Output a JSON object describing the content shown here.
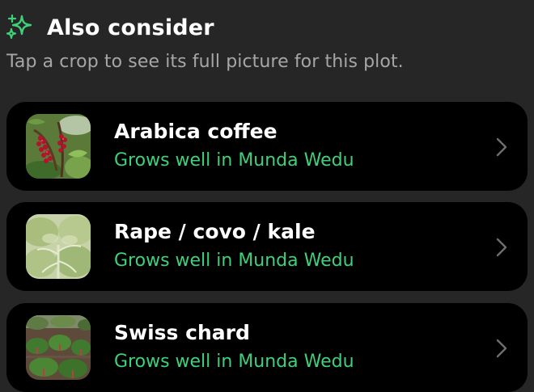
{
  "section": {
    "title": "Also consider",
    "subtitle": "Tap a crop to see its full picture for this plot.",
    "icon": "sparkles-icon",
    "accent_color": "#3ed17a"
  },
  "crops": [
    {
      "name": "Arabica coffee",
      "status": "Grows well in Munda Wedu",
      "image": "coffee-cherries-photo",
      "icon": "chevron-right-icon"
    },
    {
      "name": "Rape / covo / kale",
      "status": "Grows well in Munda Wedu",
      "image": "kale-leaves-photo",
      "icon": "chevron-right-icon"
    },
    {
      "name": "Swiss chard",
      "status": "Grows well in Munda Wedu",
      "image": "swiss-chard-field-photo",
      "icon": "chevron-right-icon"
    }
  ]
}
